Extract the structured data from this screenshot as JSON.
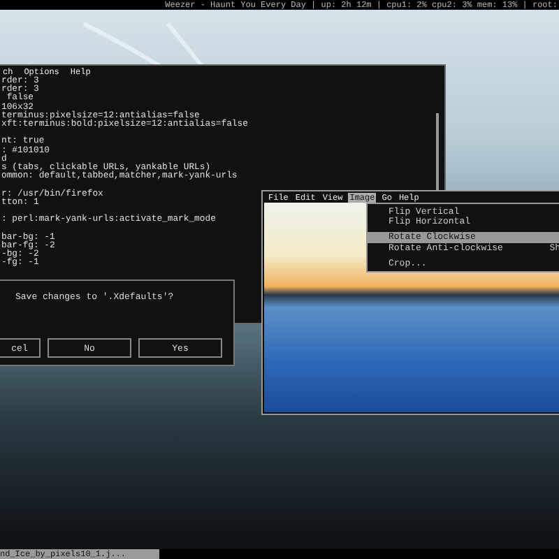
{
  "top_bar": {
    "status": "Weezer - Haunt You Every Day | up: 2h 12m | cpu1: 2% cpu2: 3% mem: 13% | root:"
  },
  "terminal": {
    "menu": [
      {
        "label": "ch",
        "selected": false
      },
      {
        "label": "Options",
        "selected": false
      },
      {
        "label": "Help",
        "selected": false
      }
    ],
    "lines": [
      {
        "text": "rder: 3",
        "blank_before": false
      },
      {
        "text": "rder: 3",
        "blank_before": false
      },
      {
        "text": " false",
        "blank_before": false
      },
      {
        "text": "106x32",
        "blank_before": false
      },
      {
        "text": "terminus:pixelsize=12:antialias=false",
        "blank_before": false
      },
      {
        "text": "xft:terminus:bold:pixelsize=12:antialias=false",
        "blank_before": false
      },
      {
        "text": "nt: true",
        "blank_before": true
      },
      {
        "text": ": #101010",
        "blank_before": false
      },
      {
        "text": "d",
        "blank_before": false
      },
      {
        "text": "s (tabs, clickable URLs, yankable URLs)",
        "blank_before": false
      },
      {
        "text": "ommon: default,tabbed,matcher,mark-yank-urls",
        "blank_before": false
      },
      {
        "text": "r: /usr/bin/firefox",
        "blank_before": true
      },
      {
        "text": "tton: 1",
        "blank_before": false
      },
      {
        "text": ": perl:mark-yank-urls:activate_mark_mode",
        "blank_before": true
      },
      {
        "text": "bar-bg: -1",
        "blank_before": true
      },
      {
        "text": "bar-fg: -2",
        "blank_before": false
      },
      {
        "text": "-bg: -2",
        "blank_before": false
      },
      {
        "text": "-fg: -1",
        "blank_before": false
      }
    ]
  },
  "dialog": {
    "message": "Save changes to '.Xdefaults'?",
    "buttons": [
      "cel",
      "No",
      "Yes"
    ]
  },
  "image_viewer": {
    "menu": [
      {
        "label": "File",
        "selected": false
      },
      {
        "label": "Edit",
        "selected": false
      },
      {
        "label": "View",
        "selected": false
      },
      {
        "label": "Image",
        "selected": true
      },
      {
        "label": "Go",
        "selected": false
      },
      {
        "label": "Help",
        "selected": false
      }
    ],
    "dropdown": [
      {
        "kind": "item",
        "label": "Flip Vertical",
        "selected": false
      },
      {
        "kind": "item",
        "label": "Flip Horizontal",
        "selected": false
      },
      {
        "kind": "separator"
      },
      {
        "kind": "item",
        "label": "Rotate Clockwise",
        "selected": true
      },
      {
        "kind": "item",
        "label": "Rotate Anti-clockwise",
        "shortcut": "Sh",
        "selected": false
      },
      {
        "kind": "separator"
      },
      {
        "kind": "item",
        "label": "Crop...",
        "selected": false
      }
    ]
  },
  "taskbar": {
    "items": [
      {
        "label": "nd_Ice_by_pixels10_1.j...",
        "selected": true
      }
    ]
  }
}
